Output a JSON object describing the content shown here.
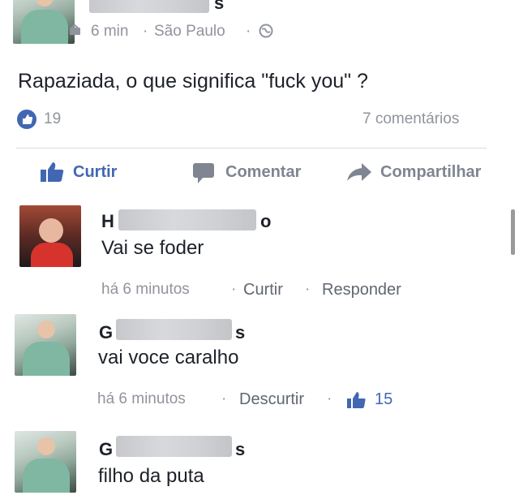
{
  "post": {
    "author_end": "s",
    "meta_time": "6 min",
    "meta_location": "São Paulo",
    "meta_sep": "·",
    "text": "Rapaziada, o que significa \"fuck you\" ?",
    "likes": "19",
    "comments": "7 comentários"
  },
  "actions": {
    "like": "Curtir",
    "comment": "Comentar",
    "share": "Compartilhar"
  },
  "comments": [
    {
      "name_start": "H",
      "name_end": "o",
      "text": "Vai se foder",
      "time": "há 6 minutos",
      "action1": "Curtir",
      "action2": "Responder",
      "sep": "·"
    },
    {
      "name_start": "G",
      "name_end": "s",
      "text": "vai voce caralho",
      "time": "há 6 minutos",
      "action1": "Descurtir",
      "likes": "15",
      "sep": "·"
    },
    {
      "name_start": "G",
      "name_end": "s",
      "text": "filho da puta"
    }
  ],
  "colors": {
    "brand_blue": "#4267b2",
    "meta_gray": "#90949c"
  }
}
